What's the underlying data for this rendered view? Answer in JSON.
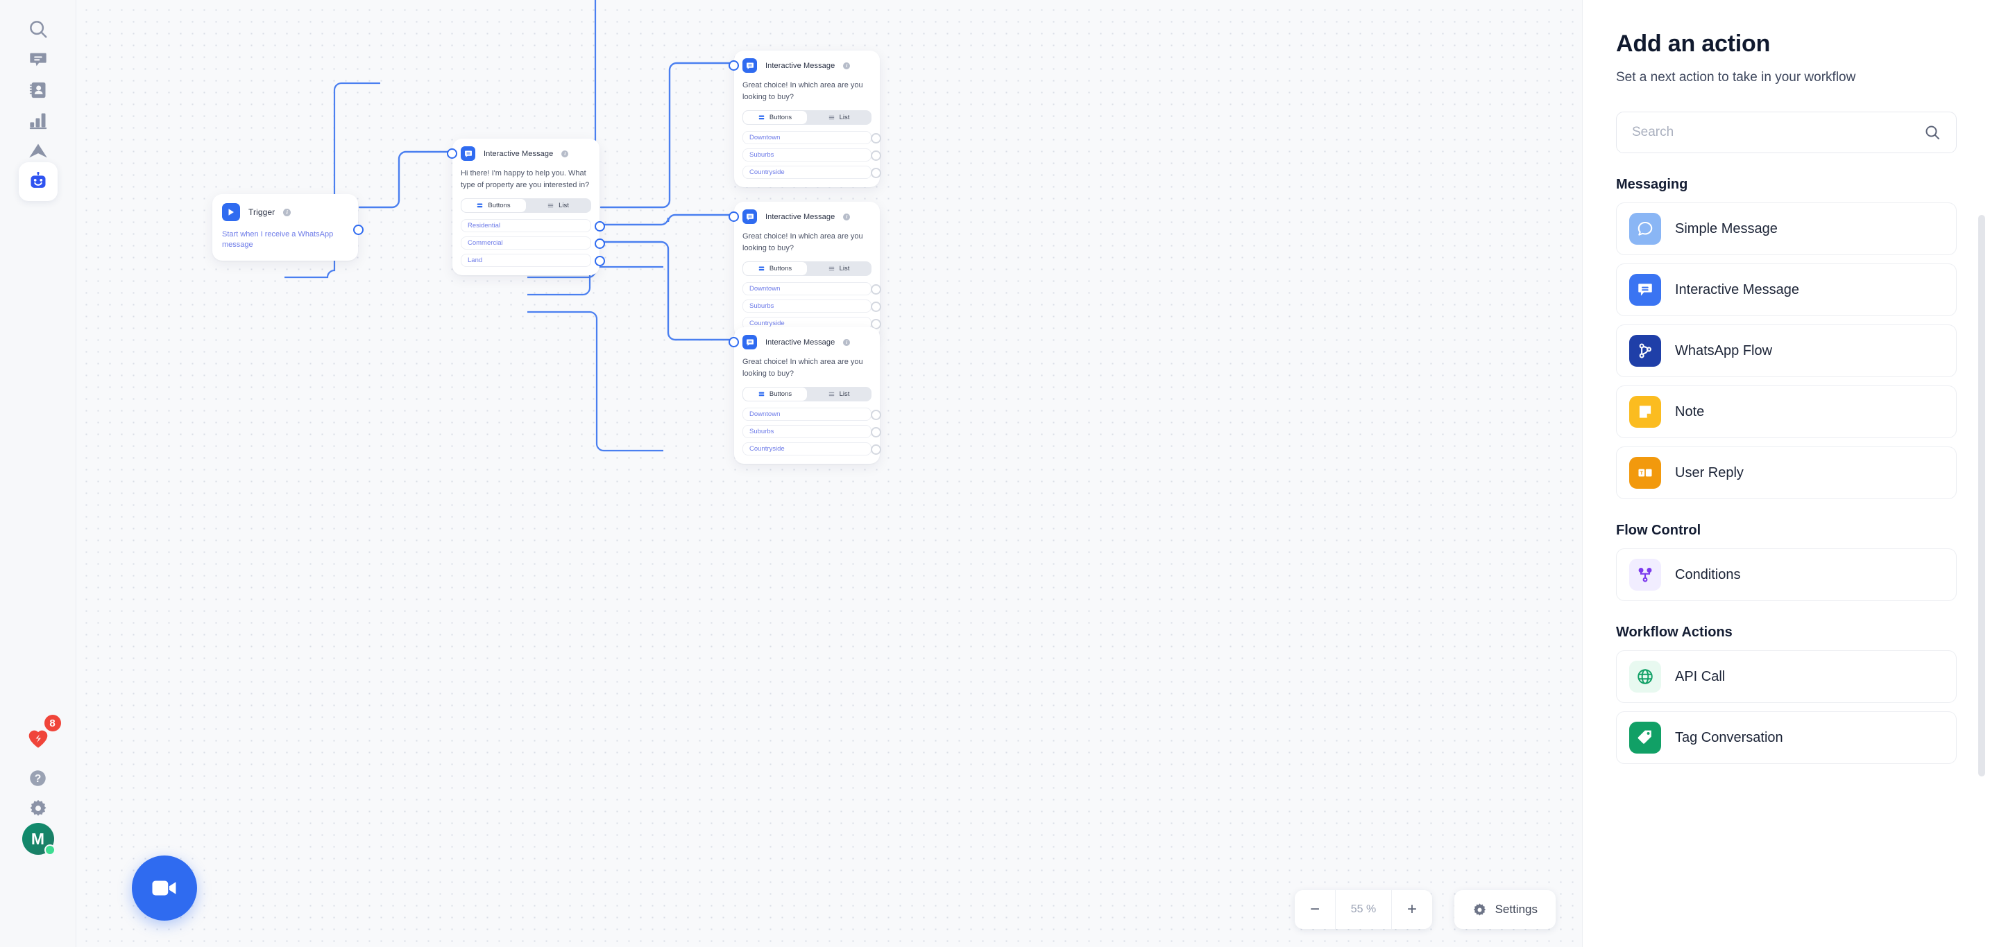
{
  "rail": {
    "items": [
      {
        "name": "search-icon",
        "label": "Search"
      },
      {
        "name": "chat-icon",
        "label": "Conversations"
      },
      {
        "name": "contacts-icon",
        "label": "Contacts"
      },
      {
        "name": "analytics-icon",
        "label": "Analytics"
      },
      {
        "name": "campaign-icon",
        "label": "Campaigns"
      },
      {
        "name": "bot-icon",
        "label": "Bots"
      }
    ],
    "notifications_label": "Notifications",
    "notifications_count": "8",
    "help_label": "Help",
    "settings_label": "Settings",
    "avatar_initial": "M"
  },
  "canvas": {
    "zoom_value": "55 %",
    "zoom_out_label": "−",
    "zoom_in_label": "+",
    "settings_label": "Settings",
    "record_label": "Record",
    "segment": {
      "buttons": "Buttons",
      "list": "List"
    },
    "trigger": {
      "title": "Trigger",
      "description": "Start when I receive a WhatsApp message"
    },
    "nodes": [
      {
        "title": "Interactive Message",
        "message": "Hi there! I'm happy to help you. What type of property are you interested in?",
        "options": [
          "Residential",
          "Commercial",
          "Land"
        ]
      },
      {
        "title": "Interactive Message",
        "message": "Great choice! In which area are you looking to buy?",
        "options": [
          "Downtown",
          "Suburbs",
          "Countryside"
        ]
      },
      {
        "title": "Interactive Message",
        "message": "Great choice! In which area are you looking to buy?",
        "options": [
          "Downtown",
          "Suburbs",
          "Countryside"
        ]
      },
      {
        "title": "Interactive Message",
        "message": "Great choice! In which area are you looking to buy?",
        "options": [
          "Downtown",
          "Suburbs",
          "Countryside"
        ]
      }
    ]
  },
  "panel": {
    "title": "Add an action",
    "subtitle": "Set a next action to take in your workflow",
    "search_placeholder": "Search",
    "search_value": "",
    "groups": [
      {
        "title": "Messaging",
        "items": [
          {
            "label": "Simple Message",
            "icon": "speech-bubble-icon",
            "color": "#8ab6f5"
          },
          {
            "label": "Interactive Message",
            "icon": "interactive-bubble-icon",
            "color": "#3a74f2"
          },
          {
            "label": "WhatsApp Flow",
            "icon": "branch-icon",
            "color": "#1f3fa8"
          },
          {
            "label": "Note",
            "icon": "note-icon",
            "color": "#fbbc20"
          },
          {
            "label": "User Reply",
            "icon": "user-reply-icon",
            "color": "#f2990d"
          }
        ]
      },
      {
        "title": "Flow Control",
        "items": [
          {
            "label": "Conditions",
            "icon": "conditions-icon",
            "color": "#f1edff"
          }
        ]
      },
      {
        "title": "Workflow Actions",
        "items": [
          {
            "label": "API Call",
            "icon": "globe-icon",
            "color": "#e8f9f0"
          },
          {
            "label": "Tag Conversation",
            "icon": "tag-icon",
            "color": "#11a066"
          }
        ]
      }
    ]
  },
  "colors": {
    "accent": "#2f6bf0",
    "option_text": "#6c7ae8",
    "canvas_bg": "#f8f9fb",
    "badge_red": "#f0453a"
  }
}
